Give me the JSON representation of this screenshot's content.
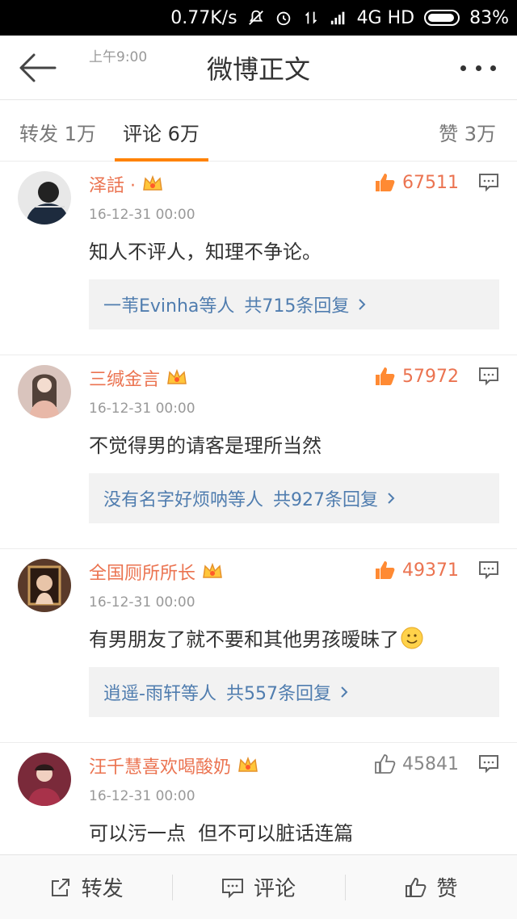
{
  "status_bar": {
    "time": "上午9:00",
    "speed": "0.77K/s",
    "network": "4G HD",
    "battery": "83%"
  },
  "header": {
    "title": "微博正文"
  },
  "tabs": {
    "repost": "转发 1万",
    "comments": "评论 6万",
    "likes": "赞 3万"
  },
  "comments": [
    {
      "user": "泽話 ·",
      "time": "16-12-31 00:00",
      "text": "知人不评人，知理不争论。",
      "likes": "67511",
      "reply_users": "一苇Evinha等人",
      "reply_count": "共715条回复"
    },
    {
      "user": "三缄金言",
      "time": "16-12-31 00:00",
      "text": "不觉得男的请客是理所当然",
      "likes": "57972",
      "reply_users": "没有名字好烦呐等人",
      "reply_count": "共927条回复"
    },
    {
      "user": "全国厕所所长",
      "time": "16-12-31 00:00",
      "text": "有男朋友了就不要和其他男孩暧昧了",
      "likes": "49371",
      "reply_users": "逍遥-雨轩等人",
      "reply_count": "共557条回复"
    },
    {
      "user": "汪千慧喜欢喝酸奶",
      "time": "16-12-31 00:00",
      "text": "可以污一点  但不可以脏话连篇",
      "likes": "45841"
    }
  ],
  "toolbar": {
    "repost": "转发",
    "comment": "评论",
    "like": "赞"
  },
  "colors": {
    "accent": "#ff8200",
    "username": "#eb7350",
    "link": "#507daf"
  }
}
